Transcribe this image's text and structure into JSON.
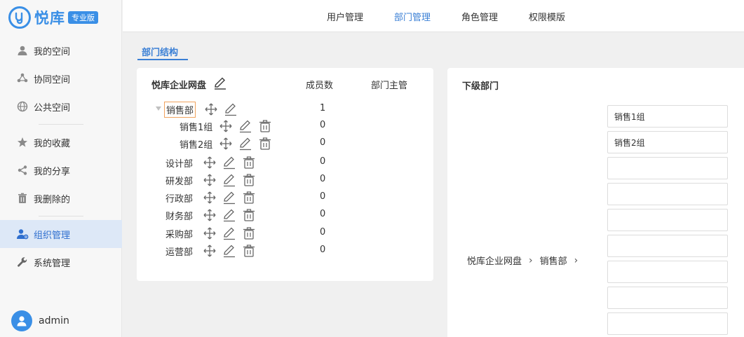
{
  "brand": {
    "logo_mark": "ty",
    "name": "悦库",
    "edition": "专业版"
  },
  "sidebar": {
    "items": [
      {
        "label": "我的空间",
        "icon": "person-icon"
      },
      {
        "label": "协同空间",
        "icon": "collab-icon"
      },
      {
        "label": "公共空间",
        "icon": "globe-icon"
      },
      {
        "label": "我的收藏",
        "icon": "star-icon"
      },
      {
        "label": "我的分享",
        "icon": "share-icon"
      },
      {
        "label": "我删除的",
        "icon": "trash-icon"
      },
      {
        "label": "组织管理",
        "icon": "org-user-icon",
        "active": true
      },
      {
        "label": "系统管理",
        "icon": "wrench-icon"
      }
    ],
    "user": {
      "name": "admin"
    }
  },
  "topbar": {
    "tabs": [
      {
        "label": "用户管理"
      },
      {
        "label": "部门管理",
        "active": true
      },
      {
        "label": "角色管理"
      },
      {
        "label": "权限模版"
      }
    ]
  },
  "subtab": {
    "label": "部门结构"
  },
  "tree": {
    "root_label": "悦库企业网盘",
    "col_members": "成员数",
    "col_manager": "部门主管",
    "rows": [
      {
        "name": "销售部",
        "members": "1",
        "selected": true,
        "indent": 0
      },
      {
        "name": "销售1组",
        "members": "0",
        "indent": 1
      },
      {
        "name": "销售2组",
        "members": "0",
        "indent": 1
      },
      {
        "name": "设计部",
        "members": "0",
        "indent": 0
      },
      {
        "name": "研发部",
        "members": "0",
        "indent": 0
      },
      {
        "name": "行政部",
        "members": "0",
        "indent": 0
      },
      {
        "name": "财务部",
        "members": "0",
        "indent": 0
      },
      {
        "name": "采购部",
        "members": "0",
        "indent": 0
      },
      {
        "name": "运营部",
        "members": "0",
        "indent": 0
      }
    ]
  },
  "subdepts": {
    "title": "下级部门",
    "breadcrumb": [
      "悦库企业网盘",
      "销售部"
    ],
    "inputs": [
      "销售1组",
      "销售2组",
      "",
      "",
      "",
      "",
      "",
      "",
      ""
    ]
  },
  "colors": {
    "accent": "#3a8fe6",
    "active_text": "#3a7fd5",
    "selected_border": "#f0a35e"
  }
}
